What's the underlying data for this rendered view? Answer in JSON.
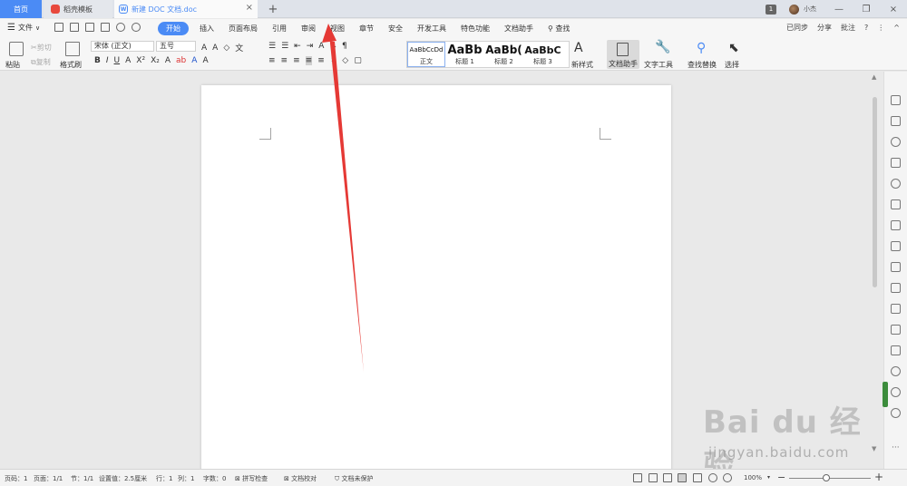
{
  "tabs": {
    "home": "首页",
    "templates": "稻壳模板",
    "doc": "新建 DOC 文档.doc",
    "close": "×",
    "add": "+"
  },
  "titlebar": {
    "badge": "1",
    "username": "小杰",
    "minimize": "—",
    "maximize": "❐",
    "close": "×"
  },
  "menubar": {
    "file": "文件",
    "items": [
      "开始",
      "插入",
      "页面布局",
      "引用",
      "审阅",
      "视图",
      "章节",
      "安全",
      "开发工具",
      "特色功能",
      "文档助手"
    ],
    "search": "查找",
    "right": [
      "已同步",
      "分享",
      "批注",
      "?",
      "⋮",
      "^"
    ]
  },
  "ribbon": {
    "paste": "粘贴",
    "cut": "剪切",
    "copy": "复制",
    "format_painter": "格式刷",
    "font_name": "宋体 (正文)",
    "font_size": "五号",
    "styles": [
      {
        "preview": "AaBbCcDd",
        "name": "正文"
      },
      {
        "preview": "AaBb",
        "name": "标题 1"
      },
      {
        "preview": "AaBb(",
        "name": "标题 2"
      },
      {
        "preview": "AaBbC",
        "name": "标题 3"
      }
    ],
    "new_style": "新样式",
    "doc_helper": "文档助手",
    "text_tools": "文字工具",
    "find_replace": "查找替换",
    "select": "选择"
  },
  "statusbar": {
    "page_num": "页码：1",
    "pages": "页面：1/1",
    "section": "节：1/1",
    "setting": "设置值：2.5厘米",
    "row": "行：1",
    "col": "列：1",
    "words": "字数：0",
    "spell": "拼写检查",
    "proof": "文档校对",
    "protect": "文档未保护",
    "zoom": "100%",
    "zoom_minus": "−",
    "zoom_plus": "+"
  },
  "watermark": {
    "logo": "Bai du 经验",
    "url": "jingyan.baidu.com"
  },
  "colors": {
    "accent": "#4b8bf5",
    "arrow": "#e53935"
  }
}
